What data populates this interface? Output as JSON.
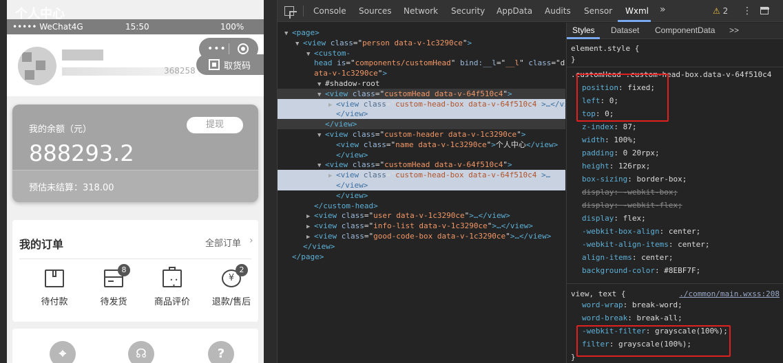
{
  "phone": {
    "title": "个人中心",
    "status": {
      "carrier": "••••• WeChat4G",
      "time": "15:50",
      "battery": "100%"
    },
    "capsule": {
      "more": "•••"
    },
    "user_suffix": "368258",
    "pickup_label": "取货码",
    "balance": {
      "label": "我的余额（元）",
      "amount": "888293.2",
      "withdraw": "提现",
      "estimate": "预估未结算：318.00"
    },
    "orders": {
      "title": "我的订单",
      "all": "全部订单",
      "items": [
        {
          "label": "待付款",
          "icon": "package-icon",
          "badge": ""
        },
        {
          "label": "待发货",
          "icon": "card-icon",
          "badge": "8"
        },
        {
          "label": "商品评价",
          "icon": "briefcase-icon",
          "badge": ""
        },
        {
          "label": "退款/售后",
          "icon": "refund-icon",
          "badge": "2"
        }
      ]
    },
    "services": [
      {
        "icon": "location-icon",
        "glyph": "⌖"
      },
      {
        "icon": "headset-icon",
        "glyph": "☊"
      },
      {
        "icon": "help-icon",
        "glyph": "?"
      }
    ]
  },
  "devtools": {
    "tabs": [
      "Console",
      "Sources",
      "Network",
      "Security",
      "AppData",
      "Audits",
      "Sensor",
      "Wxml"
    ],
    "active_tab": "Wxml",
    "more": "»",
    "warnings": "2",
    "tree": [
      {
        "indent": 0,
        "arrow": "▼",
        "html": [
          [
            "tg",
            "<page>"
          ]
        ]
      },
      {
        "indent": 1,
        "arrow": "▼",
        "html": [
          [
            "tg",
            "<view "
          ],
          [
            "an",
            "class"
          ],
          [
            "tx",
            "=\""
          ],
          [
            "av",
            "person data-v-1c3290ce"
          ],
          [
            "tx",
            "\""
          ],
          [
            "tg",
            ">"
          ]
        ]
      },
      {
        "indent": 2,
        "arrow": "▼",
        "html": [
          [
            "tg",
            "<custom-"
          ]
        ]
      },
      {
        "indent": 2,
        "arrow": "",
        "html": [
          [
            "tg",
            "head "
          ],
          [
            "an",
            "is"
          ],
          [
            "tx",
            "=\""
          ],
          [
            "av",
            "components/customHead"
          ],
          [
            "tx",
            "\" "
          ],
          [
            "an",
            "bind:__l"
          ],
          [
            "tx",
            "=\""
          ],
          [
            "av",
            "__l"
          ],
          [
            "tx",
            "\" "
          ],
          [
            "an",
            "class"
          ],
          [
            "tx",
            "=\"d"
          ]
        ]
      },
      {
        "indent": 2,
        "arrow": "",
        "html": [
          [
            "av",
            "ata-v-1c3290ce"
          ],
          [
            "tx",
            "\""
          ],
          [
            "tg",
            ">"
          ]
        ]
      },
      {
        "indent": 3,
        "arrow": "▼",
        "html": [
          [
            "tx",
            "#shadow-root"
          ]
        ]
      },
      {
        "indent": 3,
        "arrow": "▼",
        "hl": "hl2",
        "html": [
          [
            "tg",
            "<view "
          ],
          [
            "an",
            "class"
          ],
          [
            "tx",
            "=\""
          ],
          [
            "av",
            "customHead data-v-64f510c4"
          ],
          [
            "tx",
            "\""
          ],
          [
            "tg",
            ">"
          ]
        ]
      },
      {
        "indent": 4,
        "arrow": "▶",
        "hl": "hl",
        "html": [
          [
            "tg",
            "<view "
          ],
          [
            "an",
            "class"
          ],
          [
            "tx",
            "=\""
          ],
          [
            "av",
            "custom-head-box data-v-64f510c4"
          ],
          [
            "tx",
            "\""
          ],
          [
            "tg",
            ">…</view>"
          ]
        ]
      },
      {
        "indent": 4,
        "arrow": "",
        "hl": "hl",
        "html": [
          [
            "tg",
            "</view>"
          ]
        ]
      },
      {
        "indent": 3,
        "arrow": "",
        "hl": "hl2",
        "html": [
          [
            "tg",
            "</view>"
          ]
        ]
      },
      {
        "indent": 3,
        "arrow": "▼",
        "html": [
          [
            "tg",
            "<view "
          ],
          [
            "an",
            "class"
          ],
          [
            "tx",
            "=\""
          ],
          [
            "av",
            "custom-header data-v-1c3290ce"
          ],
          [
            "tx",
            "\""
          ],
          [
            "tg",
            ">"
          ]
        ]
      },
      {
        "indent": 4,
        "arrow": "",
        "html": [
          [
            "tg",
            "<view "
          ],
          [
            "an",
            "class"
          ],
          [
            "tx",
            "=\""
          ],
          [
            "av",
            "name data-v-1c3290ce"
          ],
          [
            "tx",
            "\""
          ],
          [
            "tg",
            ">"
          ],
          [
            "tx",
            "个人中心"
          ],
          [
            "tg",
            "</view>"
          ]
        ]
      },
      {
        "indent": 4,
        "arrow": "",
        "html": [
          [
            "tg",
            "</view>"
          ]
        ]
      },
      {
        "indent": 3,
        "arrow": "▼",
        "html": [
          [
            "tg",
            "<view "
          ],
          [
            "an",
            "class"
          ],
          [
            "tx",
            "=\""
          ],
          [
            "av",
            "customHead data-v-64f510c4"
          ],
          [
            "tx",
            "\""
          ],
          [
            "tg",
            ">"
          ]
        ]
      },
      {
        "indent": 4,
        "arrow": "▶",
        "hl": "hl",
        "html": [
          [
            "tg",
            "<view "
          ],
          [
            "an",
            "class"
          ],
          [
            "tx",
            "=\""
          ],
          [
            "av",
            "custom-head-box data-v-64f510c4"
          ],
          [
            "tx",
            "\""
          ],
          [
            "tg",
            ">…"
          ]
        ]
      },
      {
        "indent": 4,
        "arrow": "",
        "hl": "hl",
        "html": [
          [
            "tg",
            "</view>"
          ]
        ]
      },
      {
        "indent": 4,
        "arrow": "",
        "html": [
          [
            "tg",
            "</view>"
          ]
        ]
      },
      {
        "indent": 2,
        "arrow": "",
        "html": [
          [
            "tg",
            "</custom-head>"
          ]
        ]
      },
      {
        "indent": 2,
        "arrow": "▶",
        "html": [
          [
            "tg",
            "<view "
          ],
          [
            "an",
            "class"
          ],
          [
            "tx",
            "=\""
          ],
          [
            "av",
            "user data-v-1c3290ce"
          ],
          [
            "tx",
            "\""
          ],
          [
            "tg",
            ">…</view>"
          ]
        ]
      },
      {
        "indent": 2,
        "arrow": "▶",
        "html": [
          [
            "tg",
            "<view "
          ],
          [
            "an",
            "class"
          ],
          [
            "tx",
            "=\""
          ],
          [
            "av",
            "info-list data-v-1c3290ce"
          ],
          [
            "tx",
            "\""
          ],
          [
            "tg",
            ">…</view>"
          ]
        ]
      },
      {
        "indent": 2,
        "arrow": "▶",
        "html": [
          [
            "tg",
            "<view "
          ],
          [
            "an",
            "class"
          ],
          [
            "tx",
            "=\""
          ],
          [
            "av",
            "good-code-box data-v-1c3290ce"
          ],
          [
            "tx",
            "\""
          ],
          [
            "tg",
            ">…</view>"
          ]
        ]
      },
      {
        "indent": 1,
        "arrow": "",
        "html": [
          [
            "tg",
            "</view>"
          ]
        ]
      },
      {
        "indent": 0,
        "arrow": "",
        "html": [
          [
            "tg",
            "</page>"
          ]
        ]
      }
    ],
    "styles_tabs": [
      "Styles",
      "Dataset",
      "ComponentData",
      ">>"
    ],
    "styles": {
      "element_style": "element.style {",
      "close": "}",
      "rule1_selector": ".customHead .custom-head-box.data-v-64f510c4",
      "rule1_props": [
        {
          "p": "position",
          "v": "fixed;",
          "s": false
        },
        {
          "p": "left",
          "v": "0;",
          "s": false
        },
        {
          "p": "top",
          "v": "0;",
          "s": false
        },
        {
          "p": "z-index",
          "v": "87;",
          "s": false
        },
        {
          "p": "width",
          "v": "100%;",
          "s": false
        },
        {
          "p": "padding",
          "v": "0 20rpx;",
          "s": false
        },
        {
          "p": "height",
          "v": "126rpx;",
          "s": false
        },
        {
          "p": "box-sizing",
          "v": "border-box;",
          "s": false
        },
        {
          "p": "display",
          "v": "-webkit-box;",
          "s": true
        },
        {
          "p": "display",
          "v": "-webkit-flex;",
          "s": true
        },
        {
          "p": "display",
          "v": "flex;",
          "s": false
        },
        {
          "p": "-webkit-box-align",
          "v": "center;",
          "s": false
        },
        {
          "p": "-webkit-align-items",
          "v": "center;",
          "s": false
        },
        {
          "p": "align-items",
          "v": "center;",
          "s": false
        },
        {
          "p": "background-color",
          "v": "#8EBF7F;",
          "s": false
        }
      ],
      "rule2_selector": "view, text {",
      "rule2_source": "./common/main.wxss:208",
      "rule2_props": [
        {
          "p": "word-wrap",
          "v": "break-word;"
        },
        {
          "p": "word-break",
          "v": "break-all;"
        },
        {
          "p": "-webkit-filter",
          "v": "grayscale(100%);"
        },
        {
          "p": "filter",
          "v": "grayscale(100%);"
        }
      ]
    },
    "highlight_color": "#e12020",
    "accent_color": "#7aa9f0"
  }
}
